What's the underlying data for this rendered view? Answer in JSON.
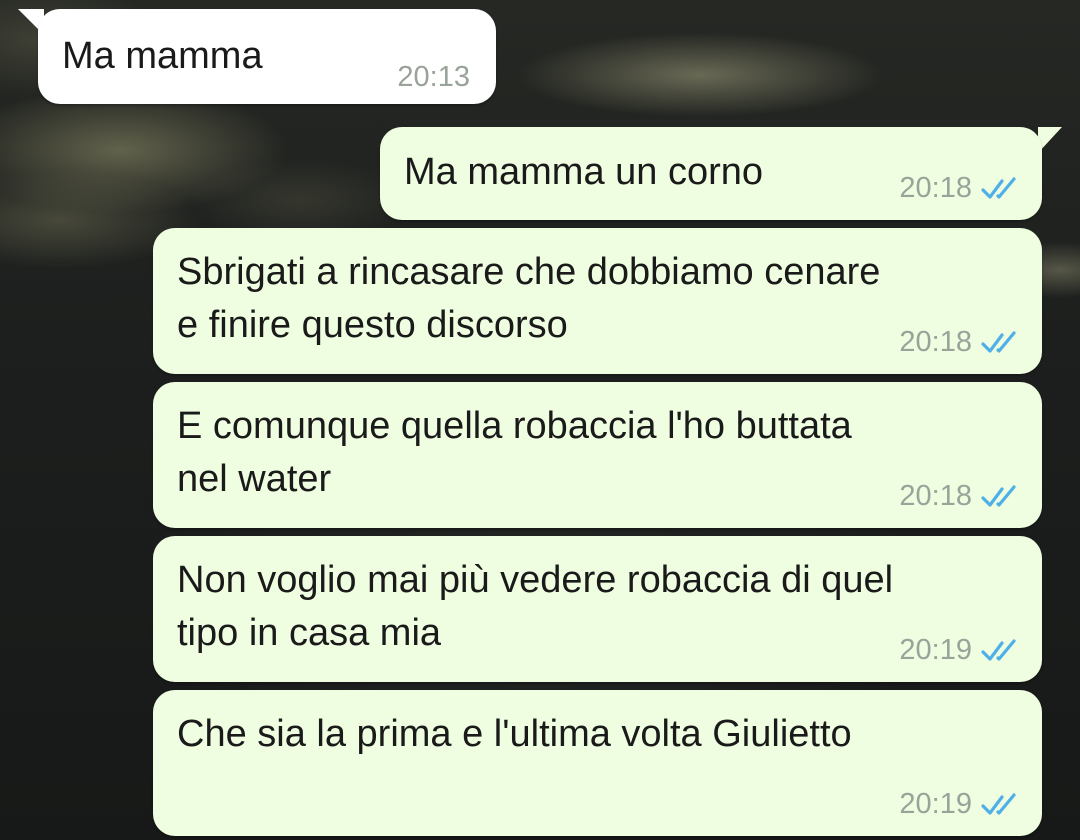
{
  "chat": {
    "messages": [
      {
        "direction": "incoming",
        "text": "Ma mamma",
        "time": "20:13"
      },
      {
        "direction": "outgoing",
        "text": "Ma mamma un corno",
        "time": "20:18",
        "status": "read-double-check-icon"
      },
      {
        "direction": "outgoing",
        "text": "Sbrigati a rincasare che dobbiamo cenare\ne finire questo discorso",
        "time": "20:18",
        "status": "read-double-check-icon"
      },
      {
        "direction": "outgoing",
        "text": "E comunque quella robaccia l'ho buttata\nnel water",
        "time": "20:18",
        "status": "read-double-check-icon"
      },
      {
        "direction": "outgoing",
        "text": "Non voglio mai più vedere robaccia di quel\ntipo in casa mia",
        "time": "20:19",
        "status": "read-double-check-icon"
      },
      {
        "direction": "outgoing",
        "text": "Che sia la prima e l'ultima volta Giulietto",
        "time": "20:19",
        "status": "read-double-check-icon"
      }
    ]
  },
  "colors": {
    "incoming_bubble": "#ffffff",
    "outgoing_bubble": "#effde0",
    "timestamp": "#9aa39a",
    "read_ticks": "#4fb0e8",
    "wallpaper": "#1c1e1d"
  }
}
